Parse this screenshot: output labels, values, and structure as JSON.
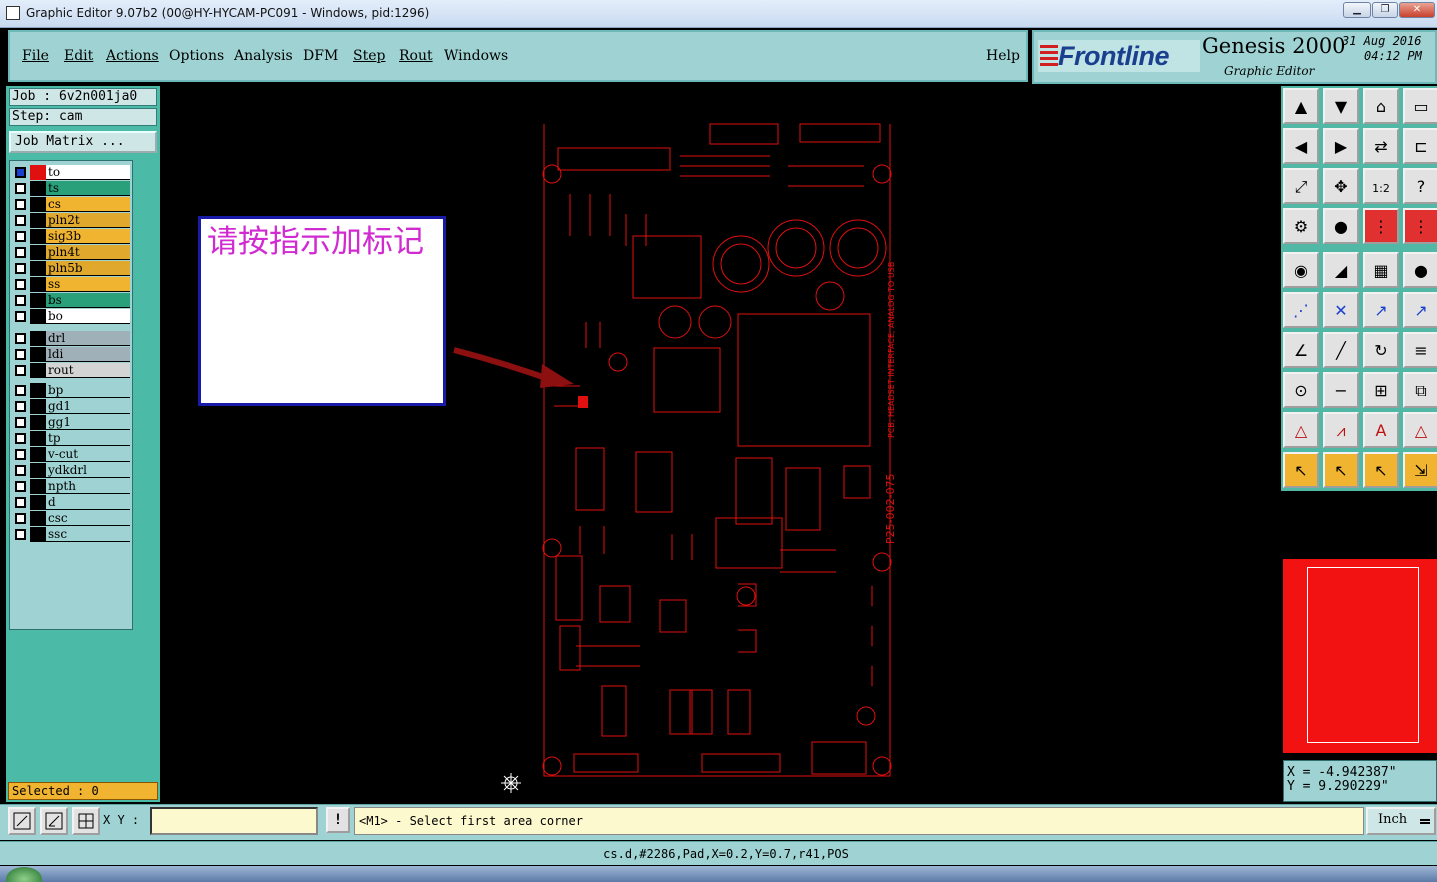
{
  "window": {
    "title": "Graphic Editor 9.07b2 (00@HY-HYCAM-PC091 - Windows, pid:1296)",
    "minimize_glyph": "▁",
    "restore_glyph": "❐",
    "close_glyph": "✕"
  },
  "menu": {
    "items": [
      "File",
      "Edit",
      "Actions",
      "Options",
      "Analysis",
      "DFM",
      "Step",
      "Rout",
      "Windows"
    ],
    "help": "Help"
  },
  "brand": {
    "logo": "Frontline",
    "product": "Genesis 2000",
    "subtitle": "Graphic Editor",
    "date": "31 Aug 2016",
    "time": "04:12 PM",
    "logo_color": "#1a3f8e",
    "stripe_color": "#d21f1f"
  },
  "left_panel": {
    "job": "Job : 6v2n001ja0",
    "step": "Step: cam",
    "job_matrix": "Job Matrix ...",
    "layers": [
      {
        "name": "to",
        "color": "#ffffff",
        "active": true
      },
      {
        "name": "ts",
        "color": "#2aa07a"
      },
      {
        "name": "cs",
        "color": "#f0b430"
      },
      {
        "name": "pln2t",
        "color": "#e1a82e"
      },
      {
        "name": "sig3b",
        "color": "#f0b430"
      },
      {
        "name": "pln4t",
        "color": "#e1a82e"
      },
      {
        "name": "pln5b",
        "color": "#e1a82e"
      },
      {
        "name": "ss",
        "color": "#f0b430"
      },
      {
        "name": "bs",
        "color": "#2aa07a"
      },
      {
        "name": "bo",
        "color": "#ffffff"
      },
      {
        "name": "drl",
        "color": "#9fb0b8"
      },
      {
        "name": "ldi",
        "color": "#9fb0b8"
      },
      {
        "name": "rout",
        "color": "#d4d4d4"
      },
      {
        "name": "bp",
        "color": "#9fd3d3"
      },
      {
        "name": "gd1",
        "color": "#9fd3d3"
      },
      {
        "name": "gg1",
        "color": "#9fd3d3"
      },
      {
        "name": "tp",
        "color": "#9fd3d3"
      },
      {
        "name": "v-cut",
        "color": "#9fd3d3"
      },
      {
        "name": "ydkdrl",
        "color": "#9fd3d3"
      },
      {
        "name": "npth",
        "color": "#9fd3d3"
      },
      {
        "name": "d",
        "color": "#9fd3d3"
      },
      {
        "name": "csc",
        "color": "#9fd3d3"
      },
      {
        "name": "ssc",
        "color": "#9fd3d3"
      }
    ],
    "selected": "Selected : 0"
  },
  "canvas": {
    "note": "请按指示加标记",
    "trace_color": "#e01010",
    "silk_text": [
      "PCB, HEADSET INTERFACE, ANALOG TO USB",
      "P25-002-075"
    ]
  },
  "toolbox": {
    "buttons": [
      "move-up-icon",
      "move-down-icon",
      "home-icon",
      "window-icon",
      "move-left-icon",
      "move-right-icon",
      "swap-icon",
      "step-icon",
      "fit-icon",
      "center-icon",
      "one-to-two-icon",
      "help-icon",
      "ruler-gear-icon",
      "pad-icon",
      "red-connect-icon",
      "red-board-icon",
      "snap-icon",
      "draw-icon",
      "measure-icon",
      "dot-icon",
      "connect-points-icon",
      "cross-delete-icon",
      "line-point-icon",
      "line-blue-icon",
      "angle-icon",
      "line-red-icon",
      "rotate-icon",
      "hatch-icon",
      "move-point-icon",
      "minus-icon",
      "measure-box-icon",
      "copy-icon",
      "triangle-fill-icon",
      "triangle-up-icon",
      "text-a-icon",
      "triangle-lines-icon",
      "select-arrow-icon",
      "select-arrow-box-icon",
      "select-arrow-diamond-icon",
      "select-net-icon"
    ]
  },
  "coords": {
    "x": "X = -4.942387\"",
    "y": "Y = 9.290229\""
  },
  "bottom": {
    "xy_label": "X Y :",
    "xy_value": "",
    "excl": "!",
    "prompt": "<M1> - Select first area corner",
    "units": "Inch"
  },
  "status": "cs.d,#2286,Pad,X=0.2,Y=0.7,r41,POS"
}
